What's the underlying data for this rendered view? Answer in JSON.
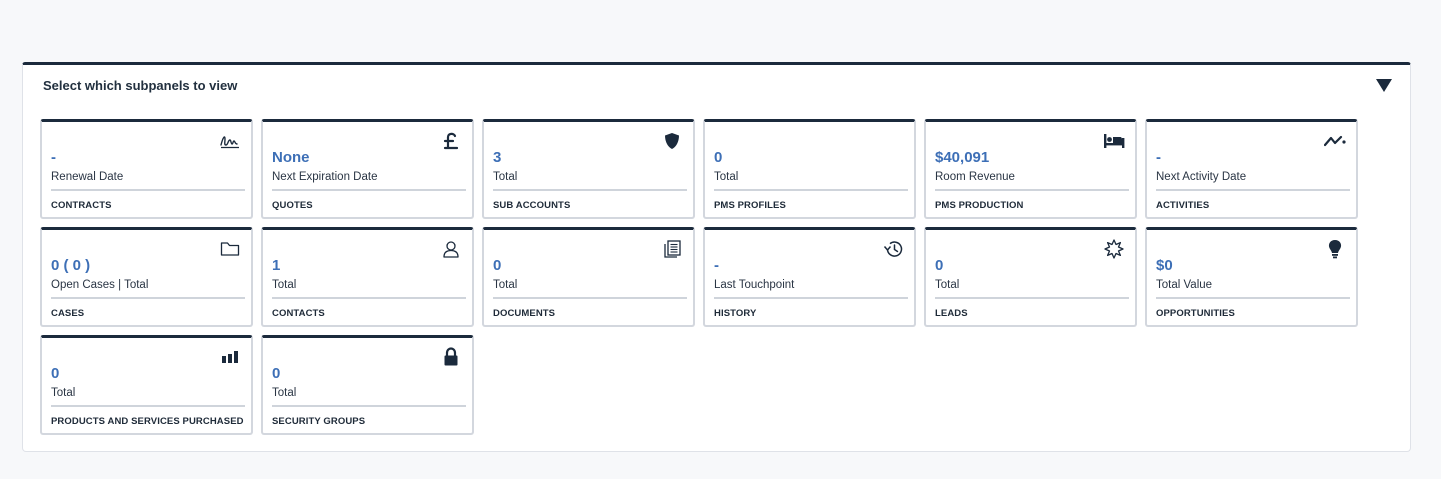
{
  "panel": {
    "title": "Select which subpanels to view"
  },
  "colors": {
    "accent": "#1b2a3c",
    "value": "#3d6fb6",
    "border": "#d3d7de"
  },
  "cards": [
    {
      "value": "-",
      "sub": "Renewal Date",
      "label": "CONTRACTS",
      "icon": "signature-icon"
    },
    {
      "value": "None",
      "sub": "Next Expiration Date",
      "label": "QUOTES",
      "icon": "pound-icon"
    },
    {
      "value": "3",
      "sub": "Total",
      "label": "SUB ACCOUNTS",
      "icon": "shield-icon"
    },
    {
      "value": "0",
      "sub": "Total",
      "label": "PMS PROFILES",
      "icon": ""
    },
    {
      "value": "$40,091",
      "sub": "Room Revenue",
      "label": "PMS PRODUCTION",
      "icon": "bed-icon"
    },
    {
      "value": "-",
      "sub": "Next Activity Date",
      "label": "ACTIVITIES",
      "icon": "activity-icon"
    },
    {
      "value": "0 ( 0 )",
      "sub": "Open Cases | Total",
      "label": "CASES",
      "icon": "folder-icon"
    },
    {
      "value": "1",
      "sub": "Total",
      "label": "CONTACTS",
      "icon": "person-icon"
    },
    {
      "value": "0",
      "sub": "Total",
      "label": "DOCUMENTS",
      "icon": "documents-icon"
    },
    {
      "value": "-",
      "sub": "Last Touchpoint",
      "label": "HISTORY",
      "icon": "history-icon"
    },
    {
      "value": "0",
      "sub": "Total",
      "label": "LEADS",
      "icon": "star-burst-icon"
    },
    {
      "value": "$0",
      "sub": "Total Value",
      "label": "OPPORTUNITIES",
      "icon": "lightbulb-icon"
    },
    {
      "value": "0",
      "sub": "Total",
      "label": "PRODUCTS AND SERVICES PURCHASED",
      "icon": "bar-chart-icon"
    },
    {
      "value": "0",
      "sub": "Total",
      "label": "SECURITY GROUPS",
      "icon": "lock-icon"
    }
  ]
}
